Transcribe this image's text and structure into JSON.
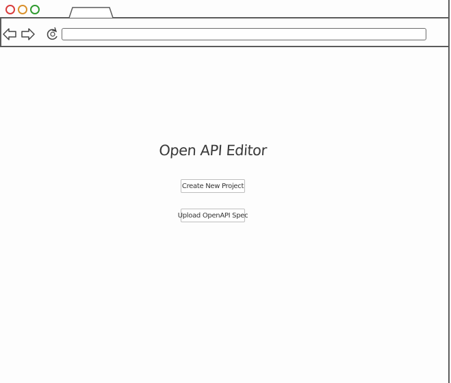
{
  "window": {
    "traffic_lights": [
      {
        "name": "close",
        "color": "#d83a3a"
      },
      {
        "name": "minimize",
        "color": "#d9902a"
      },
      {
        "name": "maximize",
        "color": "#2e9a2e"
      }
    ]
  },
  "toolbar": {
    "back_icon": "arrow-left-outline",
    "forward_icon": "arrow-right-outline",
    "reload_icon": "reload-circular-arrow",
    "address_value": ""
  },
  "main": {
    "title": "Open API Editor",
    "create_label": "Create New Project",
    "upload_label": "Upload OpenAPI Spec"
  },
  "colors": {
    "frame_stroke": "#5a5a5a",
    "text": "#3a3a3a",
    "button_border": "#bdbdbd"
  }
}
